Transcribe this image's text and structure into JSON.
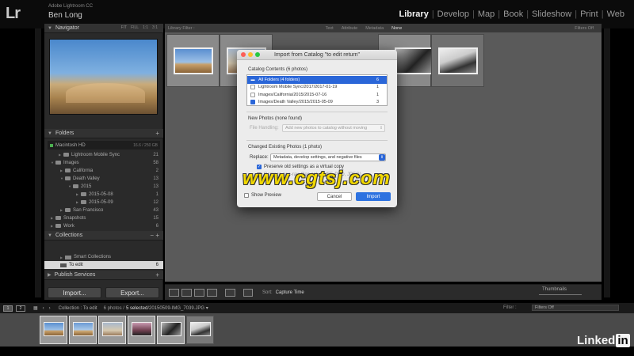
{
  "app": {
    "logo": "Lr",
    "name": "Adobe Lightroom CC",
    "user": "Ben Long"
  },
  "modules": [
    {
      "label": "Library",
      "active": true
    },
    {
      "label": "Develop"
    },
    {
      "label": "Map"
    },
    {
      "label": "Book"
    },
    {
      "label": "Slideshow"
    },
    {
      "label": "Print"
    },
    {
      "label": "Web"
    }
  ],
  "navigator": {
    "title": "Navigator",
    "zoom": [
      "FIT",
      "FILL",
      "1:1",
      "3:1"
    ]
  },
  "folders": {
    "title": "Folders",
    "add": "+",
    "volume": {
      "name": "Macintosh HD",
      "info": "16.6 / 250 GB"
    },
    "items": [
      {
        "label": "Lightroom Mobile Sync",
        "count": "21"
      },
      {
        "label": "Images",
        "count": "58"
      },
      {
        "label": "California",
        "count": "2"
      },
      {
        "label": "Death Valley",
        "count": "13"
      },
      {
        "label": "2015",
        "count": "13"
      },
      {
        "label": "2015-05-08",
        "count": "1"
      },
      {
        "label": "2015-05-09",
        "count": "12"
      },
      {
        "label": "San Francisco",
        "count": "43"
      },
      {
        "label": "Snapshots",
        "count": "15"
      },
      {
        "label": "Work",
        "count": "6"
      }
    ]
  },
  "collections": {
    "title": "Collections",
    "controls": "−  +",
    "items": [
      {
        "label": "Smart Collections",
        "count": ""
      },
      {
        "label": "To edit",
        "count": "6"
      }
    ]
  },
  "publish": {
    "title": "Publish Services",
    "add": "+"
  },
  "buttons": {
    "import": "Import...",
    "export": "Export..."
  },
  "filter_bar": {
    "label": "Library Filter :",
    "options": [
      "Text",
      "Attribute",
      "Metadata",
      "None"
    ],
    "active": "None",
    "filters_off": "Filters Off"
  },
  "dialog": {
    "title": "Import from Catalog \"to edit return\"",
    "catalog_contents": "Catalog Contents (6 photos)",
    "catalog_rows": [
      {
        "label": "All Folders (4 folders)",
        "count": "6"
      },
      {
        "label": "Lightroom Mobile Sync/2017/2017-01-19",
        "count": "1"
      },
      {
        "label": "Images/California/2015/2015-07-16",
        "count": "1"
      },
      {
        "label": "Images/Death Valley/2015/2015-05-09",
        "count": "3"
      }
    ],
    "new_photos": "New Photos (none found)",
    "file_handling_label": "File Handling:",
    "file_handling_value": "Add new photos to catalog without moving",
    "changed_photos": "Changed Existing Photos (1 photo)",
    "replace_label": "Replace:",
    "replace_value": "Metadata, develop settings, and negative files",
    "preserve_label": "Preserve old settings as a virtual copy",
    "replace_nonraw": "Replace non-raw files only (TIFF, PSD, JPEG)",
    "show_preview": "Show Preview",
    "cancel": "Cancel",
    "import": "Import"
  },
  "watermark": "www.cgtsj.com",
  "toolbar": {
    "sort_label": "Sort:",
    "sort_value": "Capture Time",
    "thumbnails": "Thumbnails"
  },
  "filmstrip": {
    "pages": [
      "1",
      "2"
    ],
    "info": "Collection : To edit",
    "count": "6 photos /",
    "selected": "5 selected",
    "file": "/20150509-IMG_7039.JPG ▾",
    "filter_label": "Filter :",
    "filters_off": "Filters Off"
  },
  "branding": {
    "linked": "Linked",
    "in": "in"
  },
  "colors": {
    "accent": "#2a66d8",
    "watermark": "#f2d800"
  }
}
